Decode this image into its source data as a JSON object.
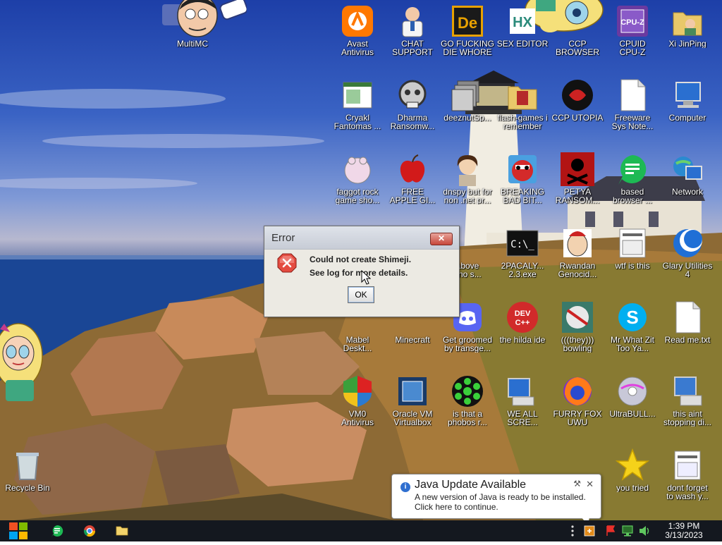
{
  "desktop": {
    "icons": [
      {
        "id": "multimc",
        "label": "MultiMC"
      },
      {
        "id": "avast",
        "label": "Avast\nAntivirus"
      },
      {
        "id": "chat",
        "label": "CHAT\nSUPPORT"
      },
      {
        "id": "gofucking",
        "label": "GO FUCKING\nDIE WHORE"
      },
      {
        "id": "sexeditor",
        "label": "SEX EDITOR"
      },
      {
        "id": "ccpbrowser",
        "label": "CCP\nBROWSER"
      },
      {
        "id": "cpuz",
        "label": "CPUID\nCPU-Z"
      },
      {
        "id": "xijinping",
        "label": "Xi JinPing"
      },
      {
        "id": "cryakl",
        "label": "Cryakl\nFantomas ..."
      },
      {
        "id": "dharma",
        "label": "Dharma\nRansomw..."
      },
      {
        "id": "deeznut",
        "label": "deeznutSp..."
      },
      {
        "id": "flashgames",
        "label": "flash-games i\nremember"
      },
      {
        "id": "ccputopia",
        "label": "CCP UTOPIA"
      },
      {
        "id": "freeware",
        "label": "Freeware\nSys Note..."
      },
      {
        "id": "computer",
        "label": "Computer"
      },
      {
        "id": "faggot",
        "label": "faggot rock\ngame sho..."
      },
      {
        "id": "freeapple",
        "label": "FREE\nAPPLE GI..."
      },
      {
        "id": "dnspy",
        "label": "dnspy but for\nnon .net pr..."
      },
      {
        "id": "breaking",
        "label": "BREAKING\nBAD BIT..."
      },
      {
        "id": "petya",
        "label": "PETYA\nRANSOM..."
      },
      {
        "id": "based",
        "label": "based\nbrowser ..."
      },
      {
        "id": "network",
        "label": "Network"
      },
      {
        "id": "above",
        "label": "above\n: no s..."
      },
      {
        "id": "2pacaly",
        "label": "2PACALY...\n2.3.exe"
      },
      {
        "id": "rwandan",
        "label": "Rwandan\nGenocid..."
      },
      {
        "id": "wtf",
        "label": "wtf is this"
      },
      {
        "id": "glary",
        "label": "Glary Utilities\n4"
      },
      {
        "id": "mabel",
        "label": "Mabel\nDeskt..."
      },
      {
        "id": "minecraft",
        "label": "Minecraft"
      },
      {
        "id": "groomed",
        "label": "Get groomed\nby transge..."
      },
      {
        "id": "hilda",
        "label": "the hilda ide"
      },
      {
        "id": "bowling",
        "label": "(((they)))\nbowling"
      },
      {
        "id": "mrwhat",
        "label": "Mr What Zit\nToo Ya..."
      },
      {
        "id": "readme",
        "label": "Read me.txt"
      },
      {
        "id": "vm0",
        "label": "VM0\nAntivirus"
      },
      {
        "id": "oraclevm",
        "label": "Oracle VM\nVirtualbox"
      },
      {
        "id": "phobos",
        "label": "is that a\nphobos r..."
      },
      {
        "id": "weall",
        "label": "WE ALL\nSCRE..."
      },
      {
        "id": "furryfox",
        "label": "FURRY FOX\nUWU"
      },
      {
        "id": "ultrabull",
        "label": "UltraBULL..."
      },
      {
        "id": "thisaint",
        "label": "this aint\nstopping di..."
      },
      {
        "id": "recycle",
        "label": "Recycle Bin"
      },
      {
        "id": "youtried",
        "label": "you tried"
      },
      {
        "id": "dontforget",
        "label": "dont forget\nto wash y..."
      }
    ]
  },
  "dialog": {
    "title": "Error",
    "message_line1": "Could not create Shimeji.",
    "message_line2": "See log for more details.",
    "ok_label": "OK",
    "close_glyph": "✕"
  },
  "notification": {
    "title": "Java Update Available",
    "line1": "A new version of Java is ready to be installed.",
    "line2": "Click here to continue.",
    "close_glyph": "✕",
    "pin_glyph": "⚒"
  },
  "taskbar": {
    "time": "1:39 PM",
    "date": "3/13/2023"
  },
  "colors": {
    "taskbar": "#14181f",
    "dialog_bg": "#eceae3",
    "error_red": "#d0312d",
    "java_blue": "#2f6fd0"
  }
}
